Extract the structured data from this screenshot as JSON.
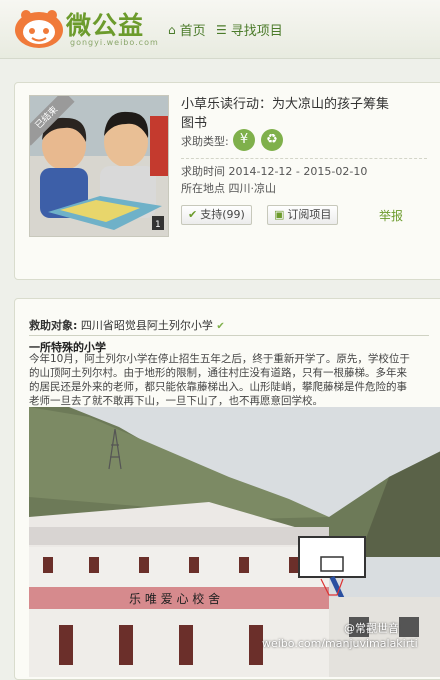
{
  "header": {
    "logo_text": "微公益",
    "logo_sub": "gongyi.weibo.com",
    "nav_home": "首页",
    "nav_find": "寻找项目"
  },
  "project": {
    "badge": "已结束",
    "title": "小草乐读行动：为大凉山的孩子筹集图书",
    "help_type_label": "求助类型:",
    "help_type_icons": [
      "yen-icon",
      "goods-icon"
    ],
    "time_label": "求助时间",
    "time_value": "2014-12-12 - 2015-02-10",
    "location_label": "所在地点",
    "location_value": "四川·凉山",
    "support_label": "支持(99)",
    "subscribe_label": "订阅项目",
    "report_label": "举报"
  },
  "article": {
    "target_label": "救助对象:",
    "target_value": "四川省昭觉县阿土列尔小学",
    "subtitle": "一所特殊的小学",
    "lines": [
      "今年10月，阿土列尔小学在停止招生五年之后，终于重新开学了。原先，学校位于",
      "的山顶阿土列尔村。由于地形的限制，通往村庄没有道路，只有一根藤梯。多年来",
      "的居民还是外来的老师，都只能依靠藤梯出入。山形陡峭，攀爬藤梯是件危险的事",
      "老师一旦去了就不敢再下山，一旦下山了，也不再愿意回学校。"
    ],
    "school_sign": "乐 唯 爱 心 校 舍"
  },
  "watermark": {
    "account": "@常觀世音",
    "url": "weibo.com/manjuvimalakirti"
  }
}
